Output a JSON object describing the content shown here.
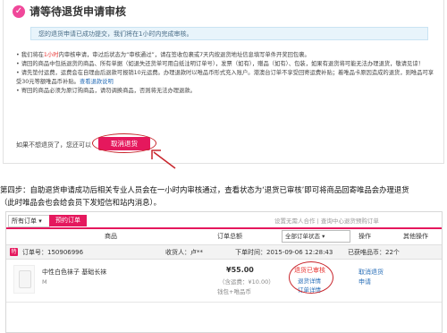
{
  "pending": {
    "title": "请等待退货申请审核",
    "notice": "您的退货申请已成功提交，我们将在1小时内完成审核。",
    "bullets": [
      {
        "pre": "我们将在",
        "red": "1小时",
        "post": "内审核申请，审过后状态为“审核通过”，请在签收包裹或7天内按退货地址信息填写单件开奖回包裹。"
      },
      {
        "pre": "请回的商品中包括退货的商品、所有单据（如退失还货单可用白纸注明订单号），发票（如有），赠品（如有）、包装，如果有退货将可能无法办理退货，敬请见谅！",
        "red": "",
        "post": ""
      },
      {
        "pre": "请先垫付运费，运费会在自理由后退款可报销10元运费。办理退款时以唯品币形式充入账户。港澳台订单不享受回寄运费补贴；着唯品卡原因造成的退货，则唯品可享受30元等额唯品币补贴。",
        "red": "",
        "post": "",
        "link": "查看退款说明"
      },
      {
        "pre": "寄回的商品必须为原订购商品，请勿调换商品，否则将无法办理退款。",
        "red": "",
        "post": ""
      }
    ],
    "cancel_prompt": "如果不想退货了，您还可以",
    "cancel_button": "取消退货"
  },
  "step": {
    "line1": "第四步：自助退货申请成功后相关专业人员会在一小时内审核通过，查看状态为‘退货已审核’即可将商品回寄唯品会办理退货",
    "line2": "（此时唯品会也会给会员下发短信和站内消息）。"
  },
  "orders": {
    "tab_label": "所有订单",
    "preorder_label": "预约订单",
    "filter_text": "设置无需人合作 | 查询中心退货预购订单",
    "headers": {
      "goods": "商品",
      "total": "订单总额",
      "status_select": "全部订单状态",
      "op": "操作",
      "other": "其他操作"
    },
    "row": {
      "vip": "特",
      "order_no": "订单号：150906996",
      "receiver": "收货人：卢**",
      "order_time": "下单时间：2015-09-06 12:28:43",
      "expire": "已获唯品币：22个"
    },
    "item": {
      "name": "中性白色袜子 基础长袜",
      "size": "M",
      "price": "¥55.00",
      "fee": "（含运费：¥10.00）",
      "pay": "钱包+唯品币",
      "status": "退货已审核",
      "status_detail": "退货详情",
      "order_detail": "订单详情",
      "op1": "取消退货",
      "op2": "申请"
    }
  }
}
